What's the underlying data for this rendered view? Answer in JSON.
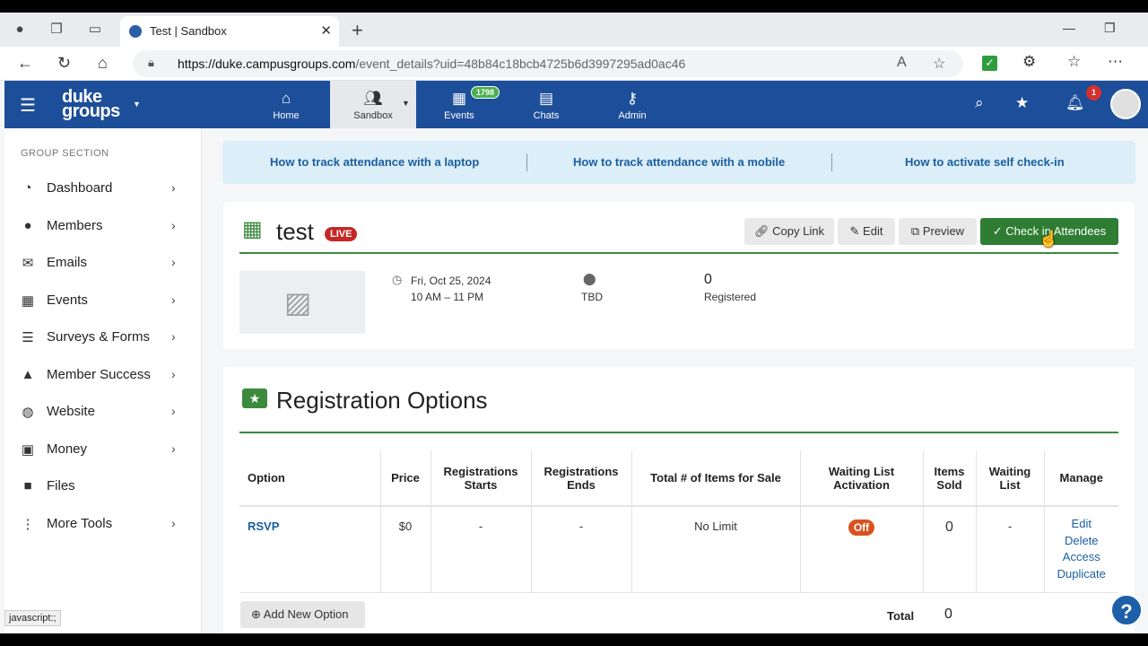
{
  "browser": {
    "tab_title": "Test | Sandbox",
    "url_domain": "https://duke.campusgroups.com",
    "url_path": "/event_details?uid=48b84c18bcb4725b6d3997295ad0ac46",
    "status_text": "javascript:;"
  },
  "header": {
    "logo_line1": "duke",
    "logo_line2": "groups",
    "nav": [
      {
        "label": "Home",
        "icon": "home-icon"
      },
      {
        "label": "Sandbox",
        "icon": "group-icon"
      },
      {
        "label": "Events",
        "icon": "calendar-icon",
        "badge": "1798"
      },
      {
        "label": "Chats",
        "icon": "chat-icon"
      },
      {
        "label": "Admin",
        "icon": "key-icon"
      }
    ],
    "notifications_badge": "1"
  },
  "sidebar": {
    "heading": "GROUP SECTION",
    "items": [
      {
        "label": "Dashboard",
        "icon": "dashboard-icon"
      },
      {
        "label": "Members",
        "icon": "person-icon"
      },
      {
        "label": "Emails",
        "icon": "mail-icon"
      },
      {
        "label": "Events",
        "icon": "calendar-icon"
      },
      {
        "label": "Surveys & Forms",
        "icon": "list-icon"
      },
      {
        "label": "Member Success",
        "icon": "graduation-cap-icon"
      },
      {
        "label": "Website",
        "icon": "globe-icon"
      },
      {
        "label": "Money",
        "icon": "money-icon"
      },
      {
        "label": "Files",
        "icon": "folder-icon"
      },
      {
        "label": "More Tools",
        "icon": "more-vertical-icon"
      }
    ]
  },
  "help_links": [
    "How to track attendance with a laptop",
    "How to track attendance with a mobile",
    "How to activate self check-in"
  ],
  "event": {
    "title": "test",
    "status": "LIVE",
    "buttons": {
      "copy_link": "Copy Link",
      "edit": "Edit",
      "preview": "Preview",
      "check_in": "Check in Attendees"
    },
    "date": "Fri, Oct 25, 2024",
    "time": "10 AM – 11 PM",
    "location": "TBD",
    "registered_count": "0",
    "registered_label": "Registered"
  },
  "registration": {
    "title": "Registration Options",
    "columns": [
      "Option",
      "Price",
      "Registrations Starts",
      "Registrations Ends",
      "Total # of Items for Sale",
      "Waiting List Activation",
      "Items Sold",
      "Waiting List",
      "Manage"
    ],
    "row": {
      "option": "RSVP",
      "price": "$0",
      "starts": "-",
      "ends": "-",
      "items_for_sale": "No Limit",
      "waiting_list_activation": "Off",
      "items_sold": "0",
      "waiting_list": "-",
      "manage": [
        "Edit",
        "Delete",
        "Access",
        "Duplicate"
      ]
    },
    "add_option": "Add New Option",
    "total_label": "Total",
    "total_value": "0"
  },
  "help_button": "?"
}
